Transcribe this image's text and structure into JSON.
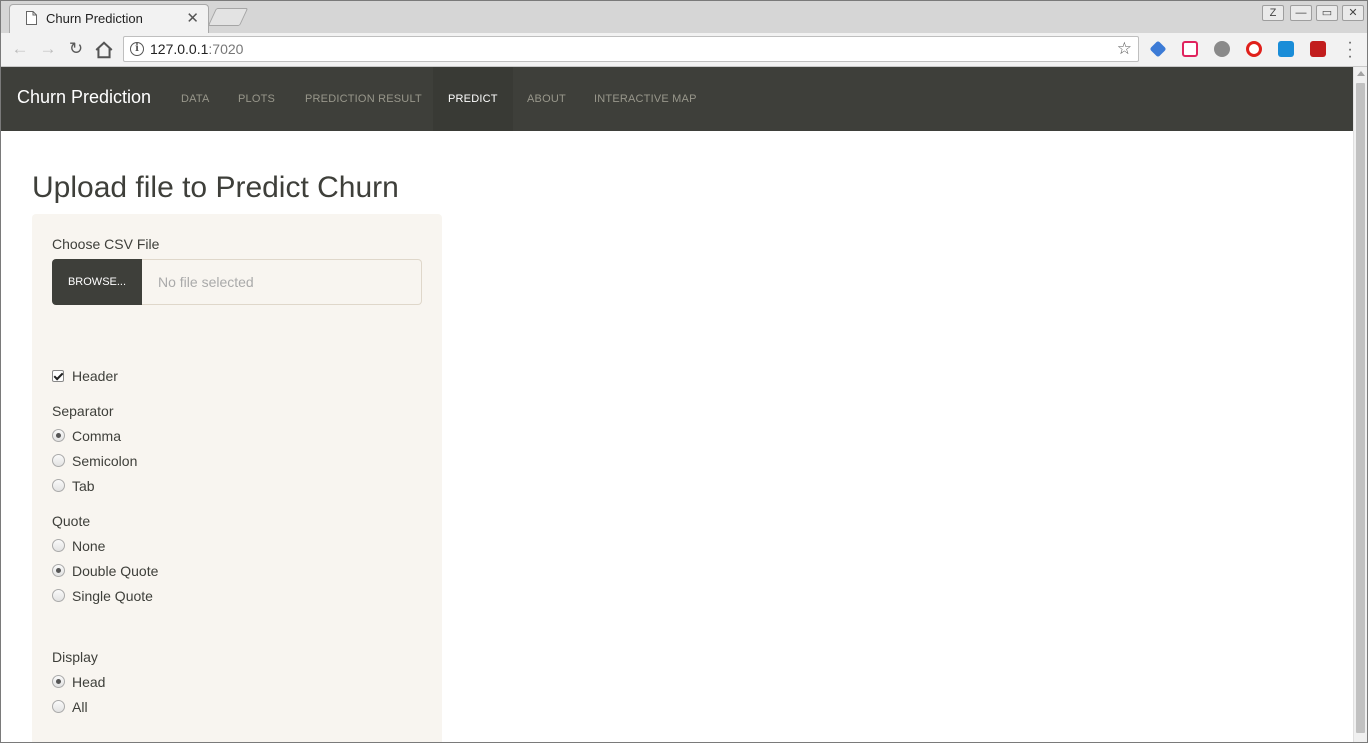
{
  "browser": {
    "tab_title": "Churn Prediction",
    "tab_close": "✕",
    "url_host": "127.0.0.1",
    "url_port": ":7020",
    "window_controls": [
      "Z",
      "—",
      "▭",
      "✕"
    ]
  },
  "navbar": {
    "brand": "Churn Prediction",
    "items": [
      {
        "label": "DATA"
      },
      {
        "label": "PLOTS"
      },
      {
        "label": "PREDICTION RESULT"
      },
      {
        "label": "PREDICT",
        "active": true
      },
      {
        "label": "ABOUT"
      },
      {
        "label": "INTERACTIVE MAP"
      }
    ],
    "bg_color": "#3e3f3a"
  },
  "main": {
    "heading": "Upload file to Predict Churn",
    "file": {
      "label": "Choose CSV File",
      "button": "BROWSE...",
      "placeholder": "No file selected"
    },
    "header_checkbox": {
      "label": "Header",
      "checked": true
    },
    "separator": {
      "label": "Separator",
      "options": [
        "Comma",
        "Semicolon",
        "Tab"
      ],
      "selected": "Comma"
    },
    "quote": {
      "label": "Quote",
      "options": [
        "None",
        "Double Quote",
        "Single Quote"
      ],
      "selected": "Double Quote"
    },
    "display": {
      "label": "Display",
      "options": [
        "Head",
        "All"
      ],
      "selected": "Head"
    }
  }
}
